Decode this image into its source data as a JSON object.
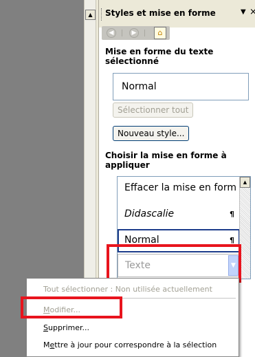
{
  "pane": {
    "title": "Styles et mise en forme",
    "dropdown_icon": "dropdown-arrow-icon",
    "close_icon": "close-icon",
    "nav": {
      "back_icon": "back-icon",
      "forward_icon": "forward-icon",
      "home_icon": "home-icon"
    }
  },
  "format_selected": {
    "heading": "Mise en forme du texte sélectionné",
    "current_style": "Normal",
    "select_all_label": "Sélectionner tout",
    "new_style_label": "Nouveau style..."
  },
  "apply_section": {
    "heading": "Choisir la mise en forme à appliquer",
    "items": [
      {
        "label": "Effacer la mise en form",
        "mark": ""
      },
      {
        "label": "Didascalie",
        "mark": "¶"
      },
      {
        "label": "Normal",
        "mark": "¶"
      },
      {
        "label": "Texte",
        "mark": ""
      }
    ]
  },
  "context_menu": {
    "items": [
      {
        "label": "Tout sélectionner : Non utilisée actuellement",
        "enabled": false
      },
      {
        "pre": "",
        "accel": "M",
        "post": "odifier...",
        "enabled": false
      },
      {
        "pre": "",
        "accel": "S",
        "post": "upprimer...",
        "enabled": true
      },
      {
        "pre": "M",
        "accel": "e",
        "post": "ttre à jour pour correspondre à la sélection",
        "enabled": true
      }
    ]
  },
  "colors": {
    "highlight": "#e8141d",
    "list_border": "#7f9db9",
    "header_bg": "#ece9d8"
  }
}
